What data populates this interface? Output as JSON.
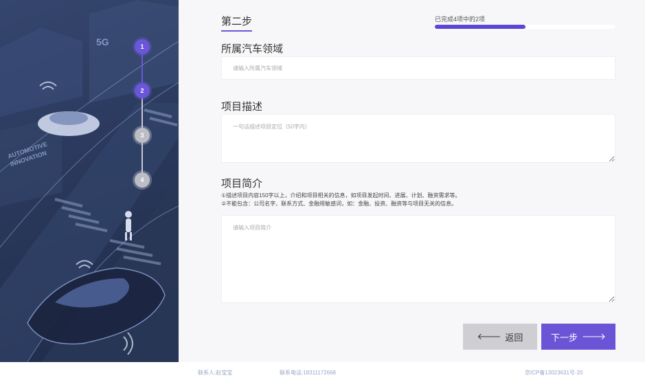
{
  "steps": [
    {
      "label": "1",
      "state": "active"
    },
    {
      "label": "2",
      "state": "active"
    },
    {
      "label": "3",
      "state": "inactive"
    },
    {
      "label": "4",
      "state": "inactive"
    }
  ],
  "scene": {
    "sign_5g": "5G",
    "sign_innovation_1": "AUTOMOTIVE",
    "sign_innovation_2": "INNOVATION"
  },
  "header": {
    "step_title": "第二步",
    "progress_text": "已完成4项中的2项",
    "progress_fraction": 0.5
  },
  "fields": {
    "domain": {
      "label": "所属汽车领域",
      "placeholder": "请输入所属汽车领域"
    },
    "description": {
      "label": "项目描述",
      "placeholder": "一句话描述项目定位（50字内）"
    },
    "intro": {
      "label": "项目简介",
      "hint1": "①描述项目内容150字以上，介绍和项目相关的信息，如项目发起时间、进展、计划、融资需求等。",
      "hint2": "②不能包含：公司名字、联系方式、金融规敏感词，如：金融、投资、融资等与项目无关的信息。",
      "placeholder": "请输入项目简介"
    }
  },
  "buttons": {
    "back_label": "返回",
    "next_label": "下一步"
  },
  "colors": {
    "accent": "#6b55d6",
    "button_gray": "#cfcfd3"
  },
  "footer": {
    "contact": "联系人:赵宝宝",
    "phone": "联系电话:18311172668",
    "icp": "京ICP备13023631号-20"
  }
}
